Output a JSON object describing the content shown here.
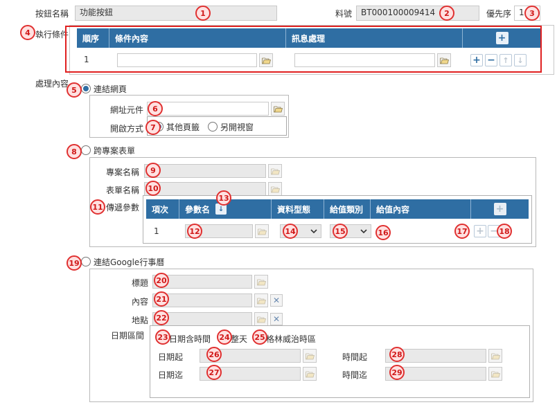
{
  "top": {
    "button_name_label": "按鈕名稱",
    "button_name_value": "功能按鈕",
    "material_no_label": "料號",
    "material_no_value": "BT000100009414",
    "priority_label": "優先序",
    "priority_value": "1"
  },
  "conditions": {
    "label": "執行條件",
    "columns": [
      "順序",
      "條件內容",
      "訊息處理"
    ],
    "row": {
      "seq": "1",
      "content": "",
      "message": ""
    }
  },
  "processing": {
    "label": "處理內容",
    "link_webpage": {
      "label": "連結網頁",
      "selected": true,
      "url_label": "網址元件",
      "url_value": "",
      "open_mode_label": "開啟方式",
      "open_other_page": "其他頁籤",
      "open_new_window": "另開視窗",
      "open_selected": "其他頁籤"
    },
    "cross_project": {
      "label": "跨專案表單",
      "selected": false,
      "project_label": "專案名稱",
      "form_label": "表單名稱",
      "params_label": "傳遞參數",
      "columns": [
        "項次",
        "參數名",
        "資料型態",
        "給值類別",
        "給值內容"
      ],
      "row": {
        "seq": "1",
        "param_name": "",
        "data_type": "",
        "value_type": "",
        "value_content": ""
      }
    },
    "google_calendar": {
      "label": "連結Google行事曆",
      "selected": false,
      "title_label": "標題",
      "content_label": "內容",
      "location_label": "地點",
      "date_range_label": "日期區間",
      "date_includes_time": "日期含時間",
      "all_day": "整天",
      "gmt_zone": "格林威治時區",
      "date_start_label": "日期起",
      "date_end_label": "日期迄",
      "time_start_label": "時間起",
      "time_end_label": "時間迄"
    }
  },
  "badges": [
    "1",
    "2",
    "3",
    "4",
    "5",
    "6",
    "7",
    "8",
    "9",
    "10",
    "11",
    "12",
    "13",
    "14",
    "15",
    "16",
    "17",
    "18",
    "19",
    "20",
    "21",
    "22",
    "23",
    "24",
    "25",
    "26",
    "27",
    "28",
    "29"
  ],
  "colors": {
    "header_blue": "#2f6ea3",
    "annotation_red": "#e02020",
    "field_gray": "#e9e9e9"
  }
}
